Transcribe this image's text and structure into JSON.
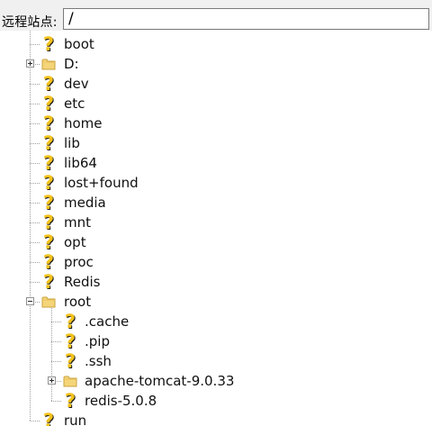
{
  "site_bar": {
    "label": "远程站点:",
    "path_value": "/"
  },
  "tree": {
    "items": [
      {
        "label": "boot",
        "icon": "question-icon",
        "depth": 1,
        "expander": "none"
      },
      {
        "label": "D:",
        "icon": "folder-icon",
        "depth": 1,
        "expander": "plus"
      },
      {
        "label": "dev",
        "icon": "question-icon",
        "depth": 1,
        "expander": "none"
      },
      {
        "label": "etc",
        "icon": "question-icon",
        "depth": 1,
        "expander": "none"
      },
      {
        "label": "home",
        "icon": "question-icon",
        "depth": 1,
        "expander": "none"
      },
      {
        "label": "lib",
        "icon": "question-icon",
        "depth": 1,
        "expander": "none"
      },
      {
        "label": "lib64",
        "icon": "question-icon",
        "depth": 1,
        "expander": "none"
      },
      {
        "label": "lost+found",
        "icon": "question-icon",
        "depth": 1,
        "expander": "none"
      },
      {
        "label": "media",
        "icon": "question-icon",
        "depth": 1,
        "expander": "none"
      },
      {
        "label": "mnt",
        "icon": "question-icon",
        "depth": 1,
        "expander": "none"
      },
      {
        "label": "opt",
        "icon": "question-icon",
        "depth": 1,
        "expander": "none"
      },
      {
        "label": "proc",
        "icon": "question-icon",
        "depth": 1,
        "expander": "none"
      },
      {
        "label": "Redis",
        "icon": "question-icon",
        "depth": 1,
        "expander": "none"
      },
      {
        "label": "root",
        "icon": "folder-icon",
        "depth": 1,
        "expander": "minus"
      },
      {
        "label": ".cache",
        "icon": "question-icon",
        "depth": 2,
        "expander": "none"
      },
      {
        "label": ".pip",
        "icon": "question-icon",
        "depth": 2,
        "expander": "none"
      },
      {
        "label": ".ssh",
        "icon": "question-icon",
        "depth": 2,
        "expander": "none"
      },
      {
        "label": "apache-tomcat-9.0.33",
        "icon": "folder-icon",
        "depth": 2,
        "expander": "plus"
      },
      {
        "label": "redis-5.0.8",
        "icon": "question-icon",
        "depth": 2,
        "expander": "none"
      },
      {
        "label": "run",
        "icon": "question-icon",
        "depth": 1,
        "expander": "none"
      }
    ]
  },
  "colors": {
    "unknown_icon": "#f2c21b",
    "folder": "#f5d57a",
    "tree_lines": "#a0a0a0",
    "bar_background": "#f0f0f0"
  }
}
